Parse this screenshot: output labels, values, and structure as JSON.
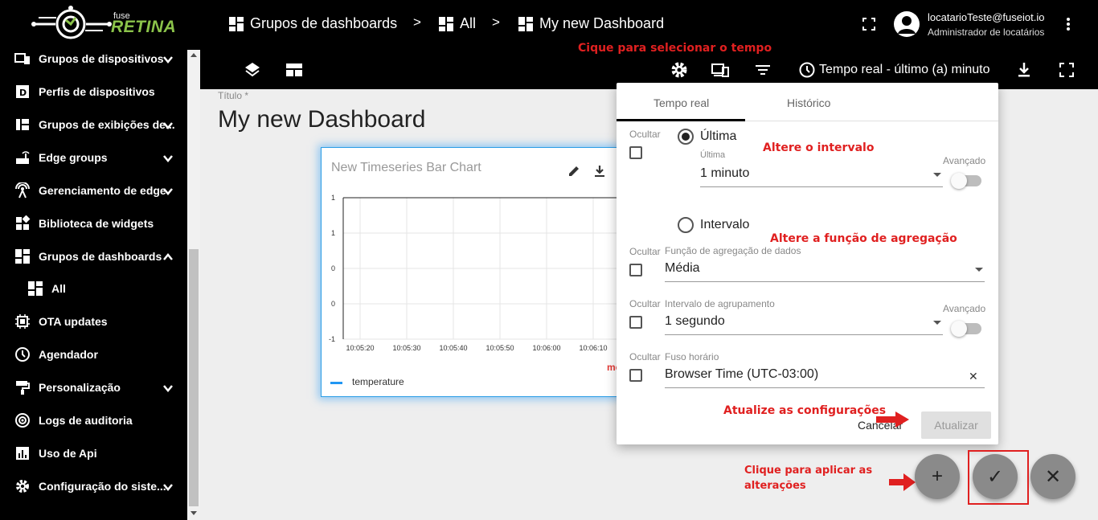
{
  "header": {
    "logo_small": "fuse",
    "logo_big": "RETINA",
    "breadcrumbs": [
      "Grupos de dashboards",
      "All",
      "My new Dashboard"
    ],
    "separator": ">",
    "user_email": "locatarioTeste@fuseiot.io",
    "user_role": "Administrador de locatários"
  },
  "toolbar": {
    "timewindow_label": "Tempo real - último (a) minuto"
  },
  "sidebar": {
    "items": [
      {
        "label": "Grupos de dispositivos",
        "icon": "devices-icon",
        "chevron": "down"
      },
      {
        "label": "Perfis de dispositivos",
        "icon": "device-profile-icon",
        "chevron": ""
      },
      {
        "label": "Grupos de exibições de...",
        "icon": "views-icon",
        "chevron": "down"
      },
      {
        "label": "Edge groups",
        "icon": "router-icon",
        "chevron": "down"
      },
      {
        "label": "Gerenciamento de edge",
        "icon": "edge-icon",
        "chevron": "down"
      },
      {
        "label": "Biblioteca de widgets",
        "icon": "widgets-icon",
        "chevron": ""
      },
      {
        "label": "Grupos de dashboards",
        "icon": "dashboard-icon",
        "chevron": "up"
      },
      {
        "label": "All",
        "icon": "dashboard-icon",
        "chevron": ""
      },
      {
        "label": "OTA updates",
        "icon": "chip-icon",
        "chevron": ""
      },
      {
        "label": "Agendador",
        "icon": "clock-icon",
        "chevron": ""
      },
      {
        "label": "Personalização",
        "icon": "paint-icon",
        "chevron": "down"
      },
      {
        "label": "Logs de auditoria",
        "icon": "audit-icon",
        "chevron": ""
      },
      {
        "label": "Uso de Api",
        "icon": "chart-icon",
        "chevron": ""
      },
      {
        "label": "Configuração do siste...",
        "icon": "gear-icon",
        "chevron": "down"
      }
    ]
  },
  "main": {
    "title_label": "Título *",
    "title_value": "My new Dashboard"
  },
  "widget": {
    "title": "New Timeseries Bar Chart",
    "legend": "temperature",
    "truncated_red_text": "me"
  },
  "chart_data": {
    "type": "bar",
    "title": "New Timeseries Bar Chart",
    "x": [
      "10:05:20",
      "10:05:30",
      "10:05:40",
      "10:05:50",
      "10:06:00",
      "10:06:10"
    ],
    "y_ticks": [
      "1",
      "1",
      "0",
      "0",
      "-1"
    ],
    "series": [
      {
        "name": "temperature",
        "values": []
      }
    ],
    "ylim": [
      -1,
      1
    ],
    "grid": true,
    "legend": "bottom-left"
  },
  "popup": {
    "tabs": [
      "Tempo real",
      "Histórico"
    ],
    "hide_label": "Ocultar",
    "last_label": "Última",
    "last_hint": "Última",
    "last_value": "1 minuto",
    "advanced": "Avançado",
    "interval_label": "Intervalo",
    "agg_label": "Função de agregação de dados",
    "agg_value": "Média",
    "group_label": "Intervalo de agrupamento",
    "group_value": "1 segundo",
    "tz_label": "Fuso horário",
    "tz_value": "Browser Time (UTC-03:00)",
    "clear": "✕",
    "cancel": "Cancelar",
    "update": "Atualizar"
  },
  "annotations": {
    "select_time": "Cique para selecionar o tempo",
    "change_interval": "Altere o intervalo",
    "change_agg": "Altere a função de agregação",
    "update_config": "Atualize as configurações",
    "apply_line1": "Clique para aplicar as",
    "apply_line2": "alterações"
  },
  "fabs": {
    "add": "+",
    "confirm": "✓",
    "close": "✕"
  },
  "colors": {
    "accent_blue": "#2196f3",
    "annotation_red": "#e02020",
    "topbar": "#000000"
  }
}
